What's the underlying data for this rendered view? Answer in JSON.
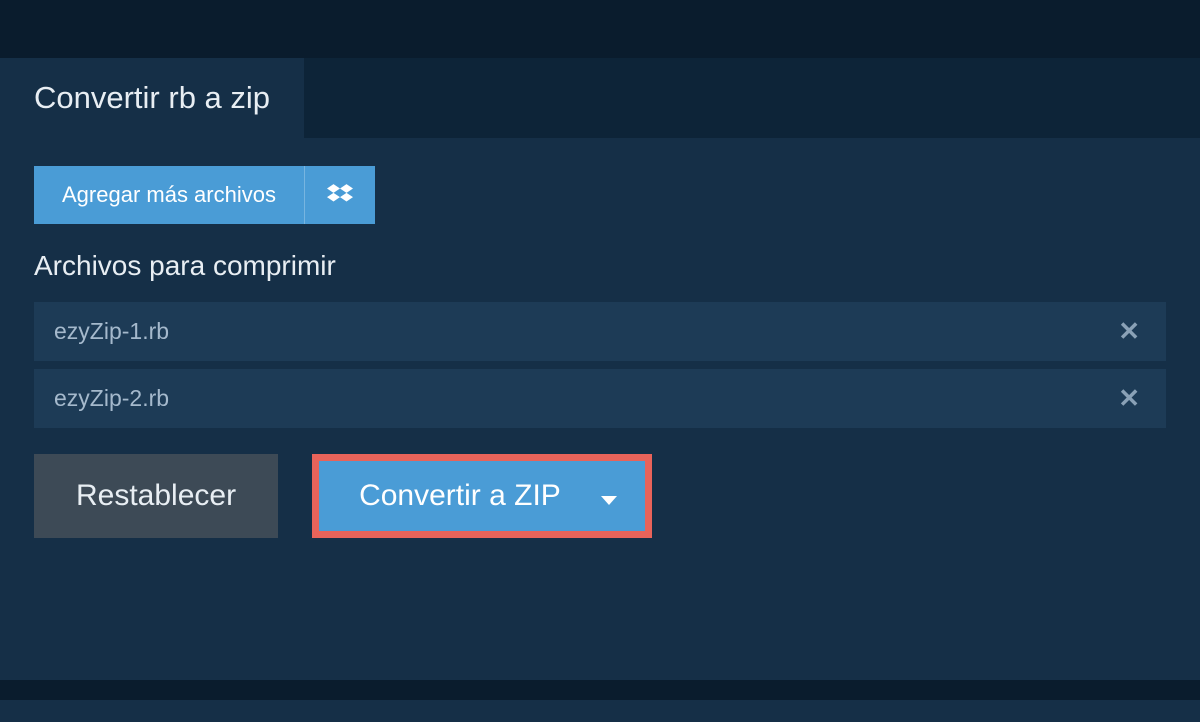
{
  "header": {
    "tab_title": "Convertir rb a zip"
  },
  "actions": {
    "add_files_label": "Agregar más archivos",
    "reset_label": "Restablecer",
    "convert_label": "Convertir a ZIP"
  },
  "section": {
    "files_heading": "Archivos para comprimir"
  },
  "files": [
    {
      "name": "ezyZip-1.rb"
    },
    {
      "name": "ezyZip-2.rb"
    }
  ],
  "icons": {
    "dropbox": "dropbox-icon",
    "close": "close-icon",
    "caret": "caret-down-icon"
  }
}
